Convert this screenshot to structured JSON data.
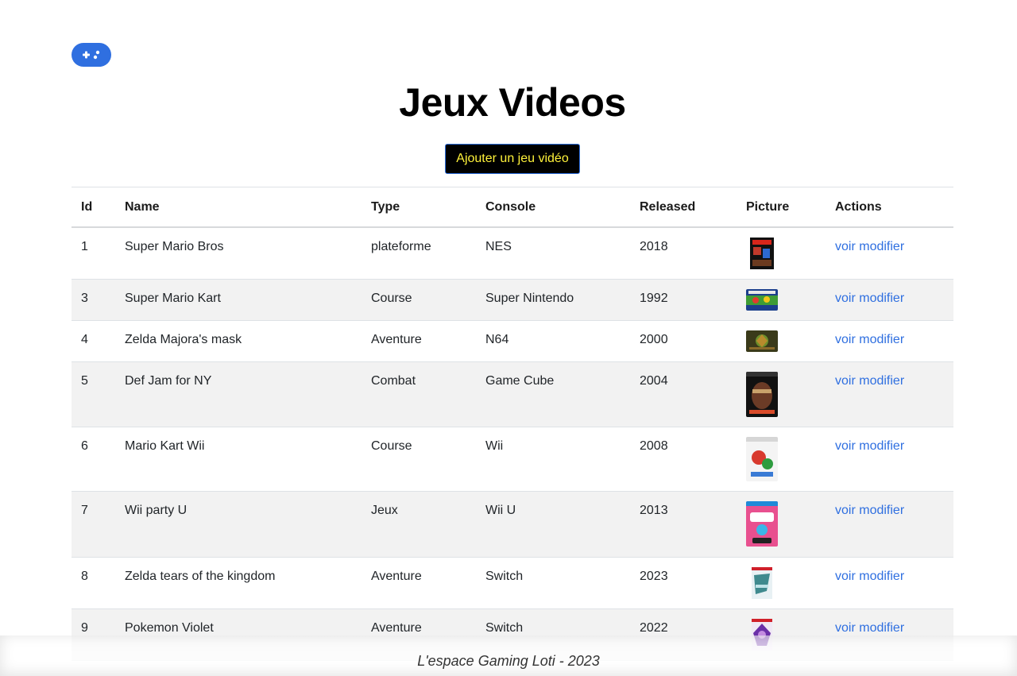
{
  "header": {
    "logo_icon": "gamepad-icon",
    "title": "Jeux Videos",
    "add_button_label": "Ajouter un jeu vidéo"
  },
  "table": {
    "columns": [
      "Id",
      "Name",
      "Type",
      "Console",
      "Released",
      "Picture",
      "Actions"
    ],
    "rows": [
      {
        "id": "1",
        "name": "Super Mario Bros",
        "type": "plateforme",
        "console": "NES",
        "released": "2018",
        "view": "voir",
        "edit": "modifier"
      },
      {
        "id": "3",
        "name": "Super Mario Kart",
        "type": "Course",
        "console": "Super Nintendo",
        "released": "1992",
        "view": "voir",
        "edit": "modifier"
      },
      {
        "id": "4",
        "name": "Zelda Majora's mask",
        "type": "Aventure",
        "console": "N64",
        "released": "2000",
        "view": "voir",
        "edit": "modifier"
      },
      {
        "id": "5",
        "name": "Def Jam for NY",
        "type": "Combat",
        "console": "Game Cube",
        "released": "2004",
        "view": "voir",
        "edit": "modifier"
      },
      {
        "id": "6",
        "name": "Mario Kart Wii",
        "type": "Course",
        "console": "Wii",
        "released": "2008",
        "view": "voir",
        "edit": "modifier"
      },
      {
        "id": "7",
        "name": "Wii party U",
        "type": "Jeux",
        "console": "Wii U",
        "released": "2013",
        "view": "voir",
        "edit": "modifier"
      },
      {
        "id": "8",
        "name": "Zelda tears of the kingdom",
        "type": "Aventure",
        "console": "Switch",
        "released": "2023",
        "view": "voir",
        "edit": "modifier"
      },
      {
        "id": "9",
        "name": "Pokemon Violet",
        "type": "Aventure",
        "console": "Switch",
        "released": "2022",
        "view": "voir",
        "edit": "modifier"
      }
    ]
  },
  "footer": {
    "text": "L'espace Gaming Loti - 2023"
  },
  "colors": {
    "accent": "#2f6fe0",
    "add_button_bg": "#000000",
    "add_button_text": "#fff23a",
    "stripe": "#f2f2f2"
  }
}
